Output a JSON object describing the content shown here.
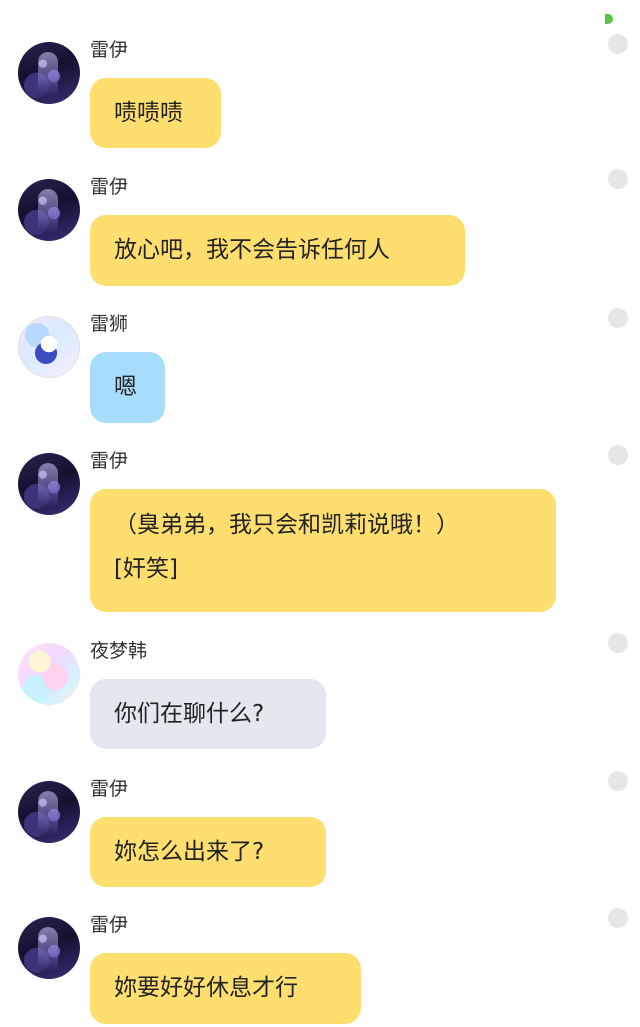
{
  "messages": [
    {
      "sender": "雷伊",
      "avatar": "lei-avatar",
      "bubble_color": "#fede6e",
      "lines": [
        "啧啧啧"
      ]
    },
    {
      "sender": "雷伊",
      "avatar": "lei-avatar",
      "bubble_color": "#fede6e",
      "lines": [
        "放心吧，我不会告诉任何人"
      ]
    },
    {
      "sender": "雷狮",
      "avatar": "leishi-avatar",
      "bubble_color": "#a7ddfa",
      "lines": [
        "嗯"
      ]
    },
    {
      "sender": "雷伊",
      "avatar": "lei-avatar",
      "bubble_color": "#fede6e",
      "lines": [
        "（臭弟弟，我只会和凯莉说哦！）",
        "[奸笑]"
      ]
    },
    {
      "sender": "夜梦韩",
      "avatar": "yemenghan-avatar",
      "bubble_color": "#e3e8ef",
      "lines": [
        "你们在聊什么?"
      ]
    },
    {
      "sender": "雷伊",
      "avatar": "lei-avatar",
      "bubble_color": "#fede6e",
      "lines": [
        "妳怎么出来了?"
      ]
    },
    {
      "sender": "雷伊",
      "avatar": "lei-avatar",
      "bubble_color": "#fede6e",
      "lines": [
        "妳要好好休息才行"
      ]
    }
  ],
  "colors": {
    "online_indicator": "#5cc24a",
    "side_dot": "#e6e6e6"
  }
}
